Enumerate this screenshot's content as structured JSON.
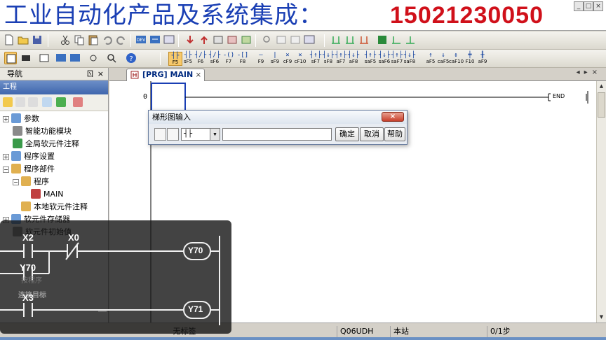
{
  "banner": {
    "title": "工业自动化产品及系统集成：",
    "phone": "15021230050"
  },
  "window_controls": [
    "minimize",
    "restore",
    "close"
  ],
  "toolbar2": {
    "ladder_keys": [
      {
        "sym": "┤├",
        "label": "F5"
      },
      {
        "sym": "┤├",
        "label": "sF5"
      },
      {
        "sym": "┤/├",
        "label": "F6"
      },
      {
        "sym": "┤/├",
        "label": "sF6"
      },
      {
        "sym": "-()",
        "label": "F7"
      },
      {
        "sym": "-[]",
        "label": "F8"
      },
      {
        "sym": "—",
        "label": "F9"
      },
      {
        "sym": "|",
        "label": "sF9"
      },
      {
        "sym": "×",
        "label": "cF9"
      },
      {
        "sym": "×",
        "label": "cF10"
      },
      {
        "sym": "┤↑├",
        "label": "sF7"
      },
      {
        "sym": "┤↓├",
        "label": "sF8"
      },
      {
        "sym": "┤↑├",
        "label": "aF7"
      },
      {
        "sym": "┤↓├",
        "label": "aF8"
      },
      {
        "sym": "┤↑├",
        "label": "saF5"
      },
      {
        "sym": "┤↓├",
        "label": "saF6"
      },
      {
        "sym": "┤↑├",
        "label": "saF7"
      },
      {
        "sym": "┤↓├",
        "label": "saF8"
      },
      {
        "sym": "↑",
        "label": "aF5"
      },
      {
        "sym": "↓",
        "label": "caF5"
      },
      {
        "sym": "↕",
        "label": "caF10"
      },
      {
        "sym": "╪",
        "label": "F10"
      },
      {
        "sym": "╫",
        "label": "aF9"
      }
    ]
  },
  "nav": {
    "title": "导航",
    "pin": "ㄖ",
    "close": "×",
    "section": "工程",
    "tree": [
      {
        "label": "参数",
        "exp": "+"
      },
      {
        "label": "智能功能模块",
        "exp": ""
      },
      {
        "label": "全局软元件注释",
        "exp": ""
      },
      {
        "label": "程序设置",
        "exp": "+"
      },
      {
        "label": "程序部件",
        "exp": "−"
      },
      {
        "label": "程序",
        "exp": "−"
      },
      {
        "label": "MAIN",
        "exp": ""
      },
      {
        "label": "本地软元件注释",
        "exp": ""
      },
      {
        "label": "软元件存储器",
        "exp": "+"
      },
      {
        "label": "软元件初始值",
        "exp": ""
      }
    ]
  },
  "tab": {
    "label": "[PRG] MAIN",
    "close": "×",
    "arrows": "◂▸×"
  },
  "ladder": {
    "step": "0",
    "end_label": "END"
  },
  "dialog": {
    "title": "梯形图输入",
    "close": "×",
    "combo_value": "┤├",
    "input_value": "",
    "ok": "确定",
    "cancel": "取消",
    "help": "帮助"
  },
  "status": {
    "label": "无标签",
    "cpu": "Q06UDH",
    "station": "本站",
    "steps": "0/1步"
  },
  "overlay": {
    "rung1_contact1": "X2",
    "rung1_contact2": "X0",
    "rung1_coil": "Y70",
    "rung2_contact": "Y70",
    "rung3_contact": "X3",
    "rung3_coil": "Y71",
    "hidden_text1": "按程序",
    "hidden_text2": "连接目标"
  }
}
